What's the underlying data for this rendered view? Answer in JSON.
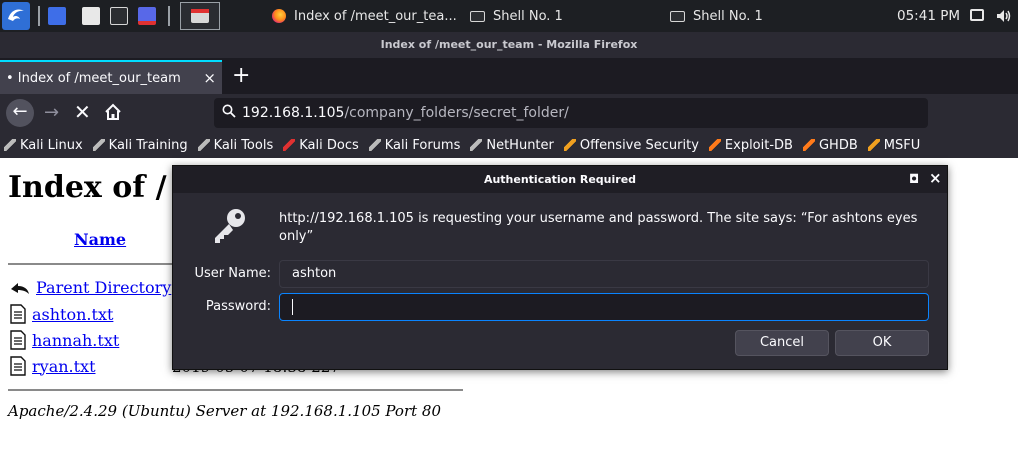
{
  "taskbar": {
    "tasks": [
      {
        "label": "Index of /meet_our_tea..."
      },
      {
        "label": "Shell No. 1"
      },
      {
        "label": "Shell No. 1"
      }
    ],
    "clock": "05:41 PM"
  },
  "window": {
    "title": "Index of /meet_our_team - Mozilla Firefox"
  },
  "tab": {
    "title": "• Index of /meet_our_team",
    "close": "×",
    "new_tab": "+"
  },
  "nav": {
    "back": "←",
    "forward": "→",
    "stop": "✕",
    "url_host": "192.168.1.105",
    "url_path": "/company_folders/secret_folder/"
  },
  "bookmarks": [
    {
      "label": "Kali Linux",
      "color": "#bbbbbb"
    },
    {
      "label": "Kali Training",
      "color": "#bbbbbb"
    },
    {
      "label": "Kali Tools",
      "color": "#bbbbbb"
    },
    {
      "label": "Kali Docs",
      "color": "#e03131"
    },
    {
      "label": "Kali Forums",
      "color": "#bbbbbb"
    },
    {
      "label": "NetHunter",
      "color": "#bbbbbb"
    },
    {
      "label": "Offensive Security",
      "color": "#f0a020"
    },
    {
      "label": "Exploit-DB",
      "color": "#ff7a1a"
    },
    {
      "label": "GHDB",
      "color": "#ff7a1a"
    },
    {
      "label": "MSFU",
      "color": "#f0a020"
    }
  ],
  "page": {
    "heading": "Index of /",
    "column_name": "Name",
    "rows": [
      {
        "label": "Parent Directory"
      },
      {
        "label": "ashton.txt"
      },
      {
        "label": "hannah.txt"
      },
      {
        "label": "ryan.txt"
      }
    ],
    "partial_date": "2019-05-07 18:38  227",
    "address": "Apache/2.4.29 (Ubuntu) Server at 192.168.1.105 Port 80"
  },
  "dialog": {
    "title": "Authentication Required",
    "controls": {
      "restore": "◘",
      "close": "×"
    },
    "message": "http://192.168.1.105 is requesting your username and password. The site says: “For ashtons eyes only”",
    "username_label": "User Name:",
    "username_value": "ashton",
    "password_label": "Password:",
    "password_value": "",
    "cancel_label": "Cancel",
    "ok_label": "OK"
  }
}
